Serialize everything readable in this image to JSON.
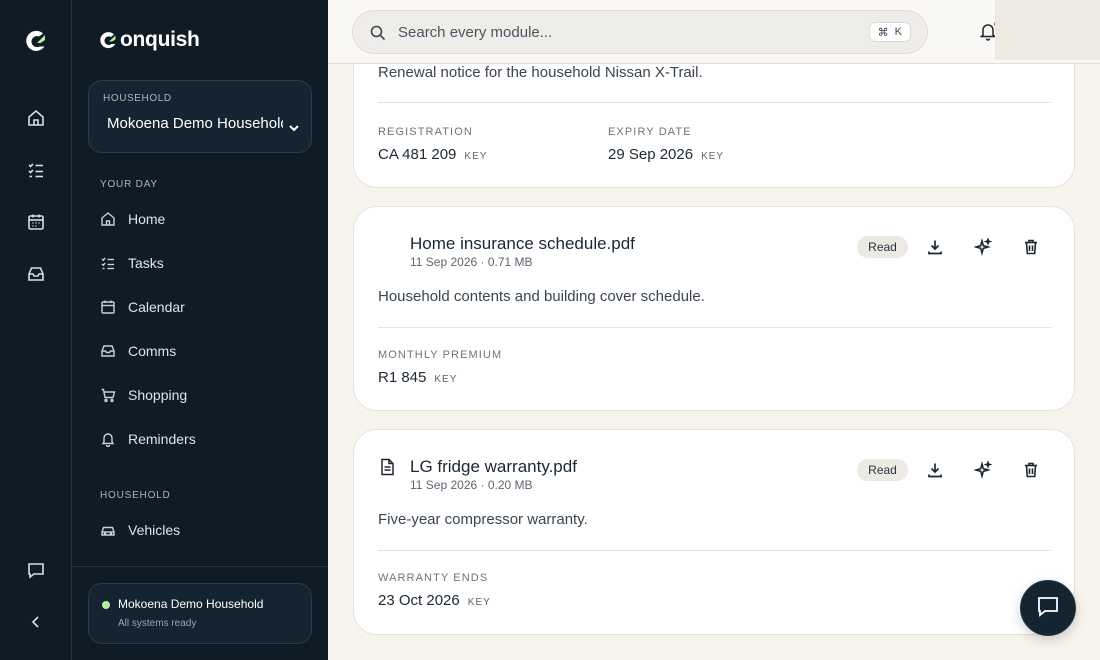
{
  "rail": {
    "icons": [
      "logo-icon",
      "home-icon",
      "tasks-icon",
      "calendar-icon",
      "inbox-icon",
      "chat-icon",
      "collapse-icon"
    ]
  },
  "sidebar": {
    "brand": "onquish",
    "household_caption": "HOUSEHOLD",
    "household_value": "Mokoena Demo Household",
    "section_your_day": "YOUR DAY",
    "items": [
      {
        "label": "Home",
        "icon": "home-icon"
      },
      {
        "label": "Tasks",
        "icon": "tasks-icon"
      },
      {
        "label": "Calendar",
        "icon": "calendar-icon"
      },
      {
        "label": "Comms",
        "icon": "inbox-icon"
      },
      {
        "label": "Shopping",
        "icon": "cart-icon"
      },
      {
        "label": "Reminders",
        "icon": "bell-icon"
      }
    ],
    "section_household": "HOUSEHOLD",
    "household_items": [
      {
        "label": "Vehicles",
        "icon": "car-icon"
      }
    ],
    "status": {
      "name": "Mokoena Demo Household",
      "sub": "All systems ready",
      "color": "#b6f09c"
    }
  },
  "topbar": {
    "search_placeholder": "Search every module...",
    "kbd_cmd": "⌘",
    "kbd_key": "K"
  },
  "cards": [
    {
      "desc": "Renewal notice for the household Nissan X-Trail.",
      "fields": [
        {
          "label": "REGISTRATION",
          "value": "CA 481 209",
          "key": "KEY"
        },
        {
          "label": "EXPIRY DATE",
          "value": "29 Sep 2026",
          "key": "KEY"
        }
      ]
    },
    {
      "title": "Home insurance schedule.pdf",
      "meta": "11 Sep 2026 · 0.71 MB",
      "badge": "Read",
      "desc": "Household contents and building cover schedule.",
      "fields": [
        {
          "label": "MONTHLY PREMIUM",
          "value": "R1 845",
          "key": "KEY"
        }
      ]
    },
    {
      "title": "LG fridge warranty.pdf",
      "meta": "11 Sep 2026 · 0.20 MB",
      "badge": "Read",
      "desc": "Five-year compressor warranty.",
      "fields": [
        {
          "label": "WARRANTY ENDS",
          "value": "23 Oct 2026",
          "key": "KEY"
        }
      ]
    }
  ],
  "colors": {
    "sidebar_bg": "#0f1c26",
    "page_bg": "#f7f4ee",
    "accent_green": "#b6f09c",
    "notification_red": "#e6493d"
  }
}
